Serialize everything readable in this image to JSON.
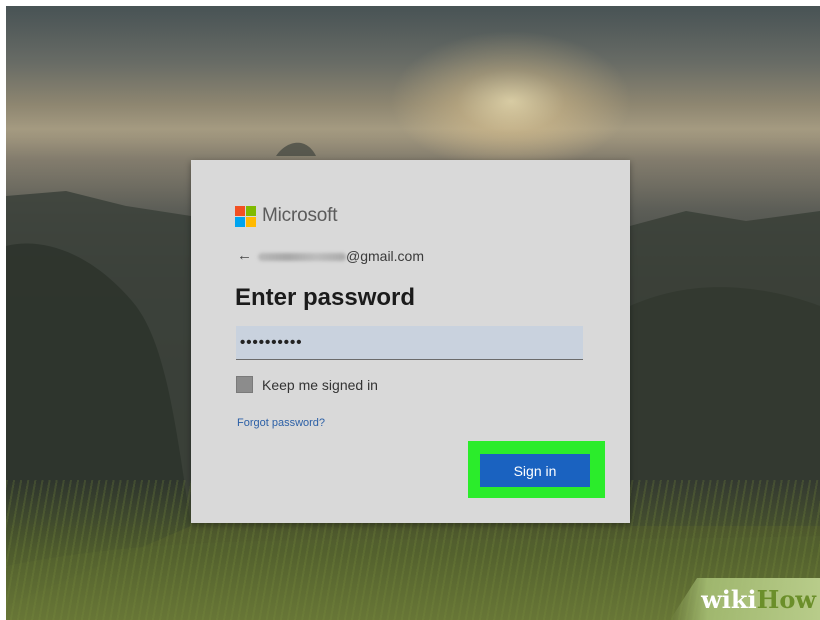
{
  "dialog": {
    "brand": {
      "name": "Microsoft",
      "logo_colors": [
        "#f25022",
        "#7fba00",
        "#00a4ef",
        "#ffb900"
      ]
    },
    "identity": {
      "back_icon": "back-arrow-icon",
      "arrow_glyph": "←",
      "email_domain": "@gmail.com"
    },
    "title": "Enter password",
    "password": {
      "value": "••••••••••"
    },
    "keep_signed_in": {
      "label": "Keep me signed in",
      "checked": false
    },
    "forgot_link": "Forgot password?",
    "sign_in_button": "Sign in",
    "accent_color": "#1a62c0",
    "highlight_color": "#2bec2b"
  },
  "watermark": {
    "part1": "wiki",
    "part2": "How"
  }
}
